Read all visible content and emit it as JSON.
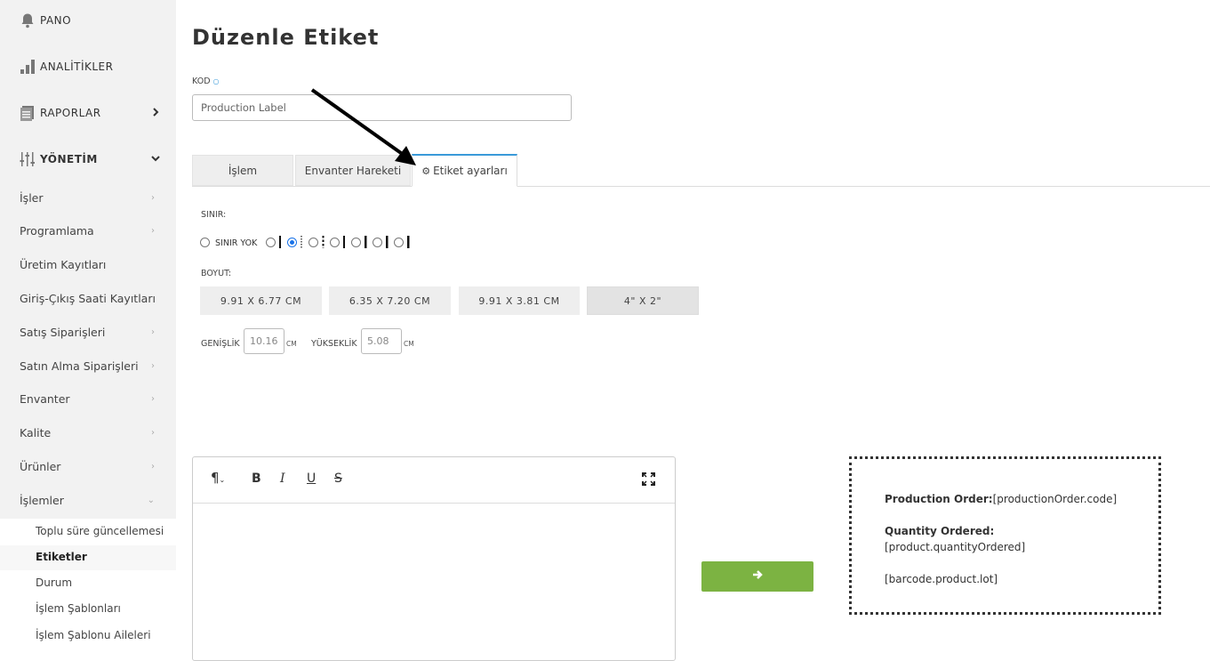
{
  "sidebar": {
    "top_items": [
      {
        "label": "PANO",
        "icon": "bell-icon"
      },
      {
        "label": "ANALİTİKLER",
        "icon": "bar-chart-icon"
      },
      {
        "label": "RAPORLAR",
        "icon": "report-icon"
      },
      {
        "label": "YÖNETİM",
        "icon": "sliders-icon"
      }
    ],
    "sub_items": [
      {
        "label": "İşler"
      },
      {
        "label": "Programlama"
      },
      {
        "label": "Üretim Kayıtları"
      },
      {
        "label": "Giriş-Çıkış Saati Kayıtları"
      },
      {
        "label": "Satış Siparişleri"
      },
      {
        "label": "Satın Alma Siparişleri"
      },
      {
        "label": "Envanter"
      },
      {
        "label": "Kalite"
      },
      {
        "label": "Ürünler"
      },
      {
        "label": "İşlemler"
      }
    ],
    "subsub_items": [
      {
        "label": "Toplu süre güncellemesi"
      },
      {
        "label": "Etiketler"
      },
      {
        "label": "Durum"
      },
      {
        "label": "İşlem Şablonları"
      },
      {
        "label": "İşlem Şablonu Aileleri"
      }
    ]
  },
  "page": {
    "title": "Düzenle Etiket",
    "kod_label": "KOD",
    "kod_value": "Production Label"
  },
  "tabs": [
    {
      "label": "İşlem"
    },
    {
      "label": "Envanter Hareketi"
    },
    {
      "label": "Etiket ayarları",
      "icon": "gear-icon"
    }
  ],
  "settings": {
    "border_label": "SINIR:",
    "no_border_label": "SINIR YOK",
    "size_label": "BOYUT:",
    "sizes": [
      "9.91 X 6.77 CM",
      "6.35 X 7.20 CM",
      "9.91 X 3.81 CM",
      "4\" X 2\""
    ],
    "width_label": "GENİŞLİK",
    "width_value": "10.16",
    "height_label": "YÜKSEKLİK",
    "height_value": "5.08",
    "unit": "CM"
  },
  "editor": {
    "tools": [
      "paragraph-icon",
      "bold-icon",
      "italic-icon",
      "underline-icon",
      "strikethrough-icon",
      "fullscreen-icon"
    ]
  },
  "preview": {
    "line1_bold": "Production Order:",
    "line1_value": "[productionOrder.code]",
    "line2_bold": "Quantity Ordered:",
    "line3": "[product.quantityOrdered]",
    "line4": "[barcode.product.lot]"
  },
  "colors": {
    "accent": "#3a9ad9",
    "go_button": "#7cb342",
    "sidebar_bg": "#f2f2f2"
  }
}
